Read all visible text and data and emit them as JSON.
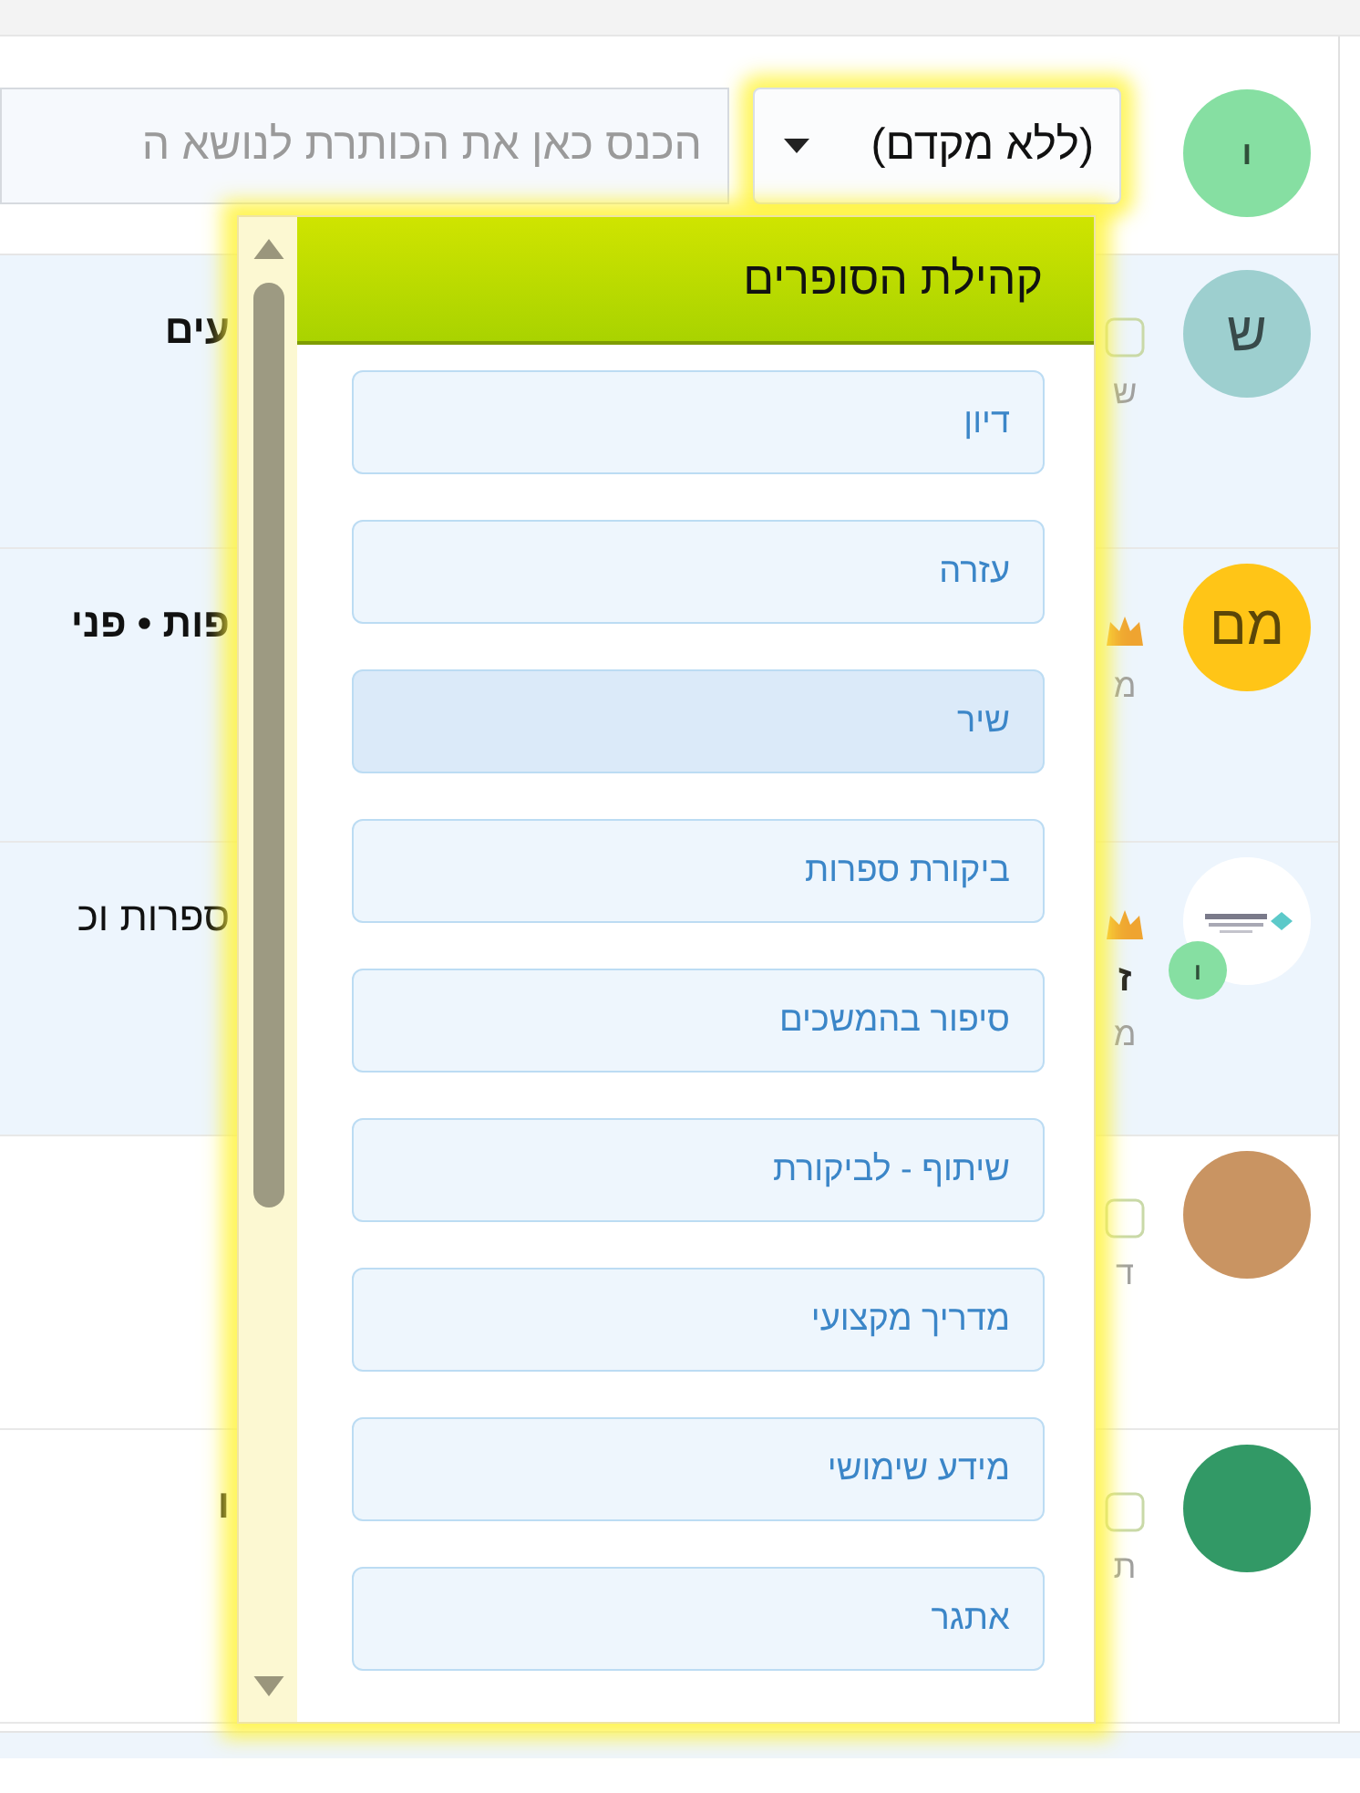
{
  "topic_form": {
    "avatar": {
      "initial": "ו",
      "color": "#86dfa2"
    },
    "prefix_select": {
      "value": "(ללא מקדם)",
      "expanded": true
    },
    "title_field": {
      "placeholder": "הכנס כאן את הכותרת לנושא ה"
    }
  },
  "topics": [
    {
      "highlighted": true,
      "avatar": {
        "kind": "letter",
        "initial": "ש",
        "color": "#9dcfcf"
      },
      "marker": {
        "kind": "square"
      },
      "side_texts": [
        {
          "kind": "muted",
          "text": "ש"
        }
      ],
      "title": "עים",
      "title_bold": true
    },
    {
      "highlighted": true,
      "avatar": {
        "kind": "letter",
        "initial": "מם",
        "color": "#ffc517"
      },
      "marker": {
        "kind": "crown"
      },
      "side_texts": [
        {
          "kind": "muted",
          "text": "מ"
        }
      ],
      "title": "פות • פני",
      "title_bold": true
    },
    {
      "highlighted": true,
      "avatar": {
        "kind": "logo",
        "badge": {
          "initial": "ו",
          "color": "#86dfa2"
        }
      },
      "marker": {
        "kind": "crown"
      },
      "side_texts": [
        {
          "kind": "strong",
          "text": "ז"
        },
        {
          "kind": "muted",
          "text": "מ"
        }
      ],
      "title": "ספרות וכ",
      "title_bold": false
    },
    {
      "highlighted": false,
      "avatar": {
        "kind": "plain",
        "color": "#c99462"
      },
      "marker": {
        "kind": "square"
      },
      "side_texts": [
        {
          "kind": "muted",
          "text": "ד"
        }
      ]
    },
    {
      "highlighted": false,
      "avatar": {
        "kind": "plain",
        "color": "#329966"
      },
      "marker": {
        "kind": "square"
      },
      "side_texts": [
        {
          "kind": "muted",
          "text": "ת"
        }
      ],
      "title": "ו",
      "title_bold": true
    }
  ],
  "prefix_menu": {
    "header": "קהילת הסופרים",
    "items": [
      {
        "label": "דיון",
        "selected": false
      },
      {
        "label": "עזרה",
        "selected": false
      },
      {
        "label": "שיר",
        "selected": true
      },
      {
        "label": "ביקורת ספרות",
        "selected": false
      },
      {
        "label": "סיפור בהמשכים",
        "selected": false
      },
      {
        "label": "שיתוף - לביקורת",
        "selected": false
      },
      {
        "label": "מדריך מקצועי",
        "selected": false
      },
      {
        "label": "מידע שימושי",
        "selected": false
      },
      {
        "label": "אתגר",
        "selected": false
      }
    ]
  }
}
